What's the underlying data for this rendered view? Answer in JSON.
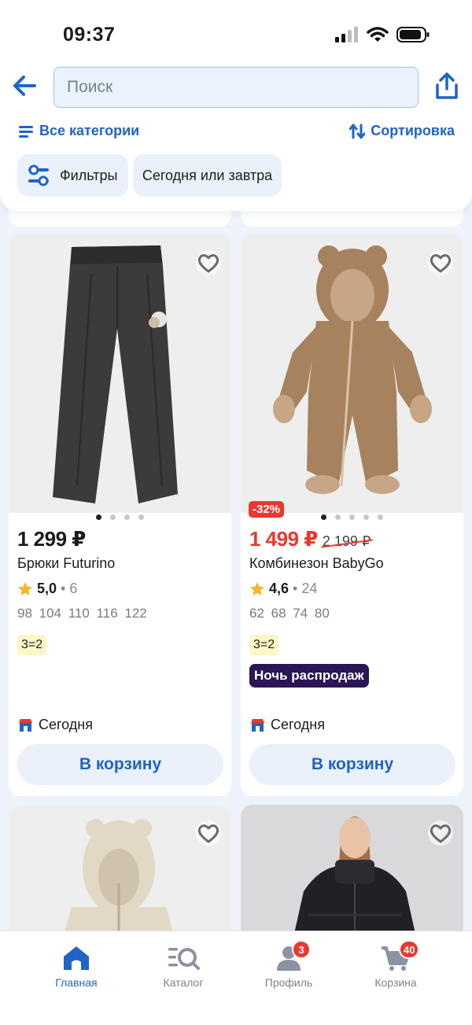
{
  "status": {
    "time": "09:37"
  },
  "search": {
    "placeholder": "Поиск"
  },
  "header": {
    "categories_label": "Все категории",
    "sort_label": "Сортировка",
    "filters_label": "Фильтры",
    "delivery_chip": "Сегодня или завтра"
  },
  "products": [
    {
      "price": "1 299 ₽",
      "title": "Брюки Futurino",
      "rating": "5,0",
      "reviews": "6",
      "sizes": "98 104 110 116 122",
      "promo": "3=2",
      "delivery": "Сегодня",
      "cart_label": "В корзину"
    },
    {
      "discount": "-32%",
      "price": "1 499 ₽",
      "old_price": "2 199 ₽",
      "title": "Комбинезон BabyGo",
      "rating": "4,6",
      "reviews": "24",
      "sizes": "62 68 74 80",
      "promo": "3=2",
      "tag": "Ночь распродаж",
      "delivery": "Сегодня",
      "cart_label": "В корзину"
    }
  ],
  "tabbar": {
    "home": "Главная",
    "catalog": "Каталог",
    "profile": "Профиль",
    "profile_badge": "3",
    "cart": "Корзина",
    "cart_badge": "40"
  },
  "colors": {
    "accent": "#2064c6",
    "sale": "#e9392e",
    "night_tag": "#2b1554",
    "promo_bg": "#fdf6c5"
  }
}
